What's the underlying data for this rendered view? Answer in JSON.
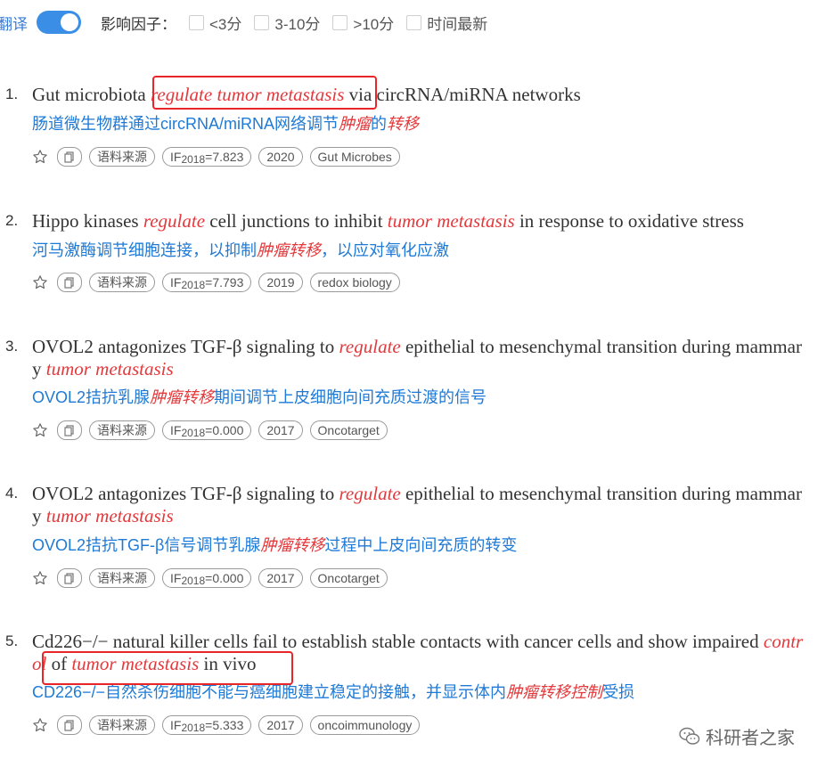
{
  "toolbar": {
    "translate_label": "翻译",
    "filter_label": "影响因子：",
    "filters": [
      "<3分",
      "3-10分",
      ">10分",
      "时间最新"
    ]
  },
  "results": [
    {
      "index": "1.",
      "title_parts": [
        "Gut microbiota ",
        "regulate tumor metastasis",
        " via circRNA/miRNA networks"
      ],
      "zh_parts": [
        "肠道微生物群通过circRNA/miRNA网络调节",
        "肿瘤",
        "的",
        "转移",
        ""
      ],
      "corpus_label": "语料来源",
      "if_prefix": "IF",
      "if_year": "2018",
      "if_value": "=7.823",
      "year": "2020",
      "journal": "Gut Microbes"
    },
    {
      "index": "2.",
      "title_parts": [
        "Hippo kinases ",
        "regulate",
        " cell junctions to inhibit ",
        "tumor metastasis",
        " in response to oxidative stress"
      ],
      "zh_parts": [
        "河马激酶调节细胞连接，以抑制",
        "肿瘤转移",
        "，以应对氧化应激"
      ],
      "corpus_label": "语料来源",
      "if_prefix": "IF",
      "if_year": "2018",
      "if_value": "=7.793",
      "year": "2019",
      "journal": "redox biology"
    },
    {
      "index": "3.",
      "title_parts": [
        "OVOL2 antagonizes TGF-β signaling to ",
        "regulate",
        " epithelial to mesenchymal transition during mammary ",
        "tumor metastasis",
        ""
      ],
      "zh_parts": [
        "OVOL2拮抗乳腺",
        "肿瘤转移",
        "期间调节上皮细胞向间充质过渡的信号"
      ],
      "corpus_label": "语料来源",
      "if_prefix": "IF",
      "if_year": "2018",
      "if_value": "=0.000",
      "year": "2017",
      "journal": "Oncotarget"
    },
    {
      "index": "4.",
      "title_parts": [
        "OVOL2 antagonizes TGF-β signaling to ",
        "regulate",
        " epithelial to mesenchymal transition during mammary ",
        "tumor metastasis",
        ""
      ],
      "zh_parts": [
        "OVOL2拮抗TGF-β信号调节乳腺",
        "肿瘤转移",
        "过程中上皮向间充质的转变"
      ],
      "corpus_label": "语料来源",
      "if_prefix": "IF",
      "if_year": "2018",
      "if_value": "=0.000",
      "year": "2017",
      "journal": "Oncotarget"
    },
    {
      "index": "5.",
      "title_parts": [
        "Cd226−/− natural killer cells fail to establish stable contacts with cancer cells and show impaired ",
        "control",
        " of ",
        "tumor metastasis",
        " in vivo"
      ],
      "zh_parts": [
        "CD226−/−自然杀伤细胞不能与癌细胞建立稳定的接触，并显示体内",
        "肿瘤转移控制",
        "受损"
      ],
      "corpus_label": "语料来源",
      "if_prefix": "IF",
      "if_year": "2018",
      "if_value": "=5.333",
      "year": "2017",
      "journal": "oncoimmunology"
    }
  ],
  "watermark": {
    "text": "科研者之家"
  }
}
